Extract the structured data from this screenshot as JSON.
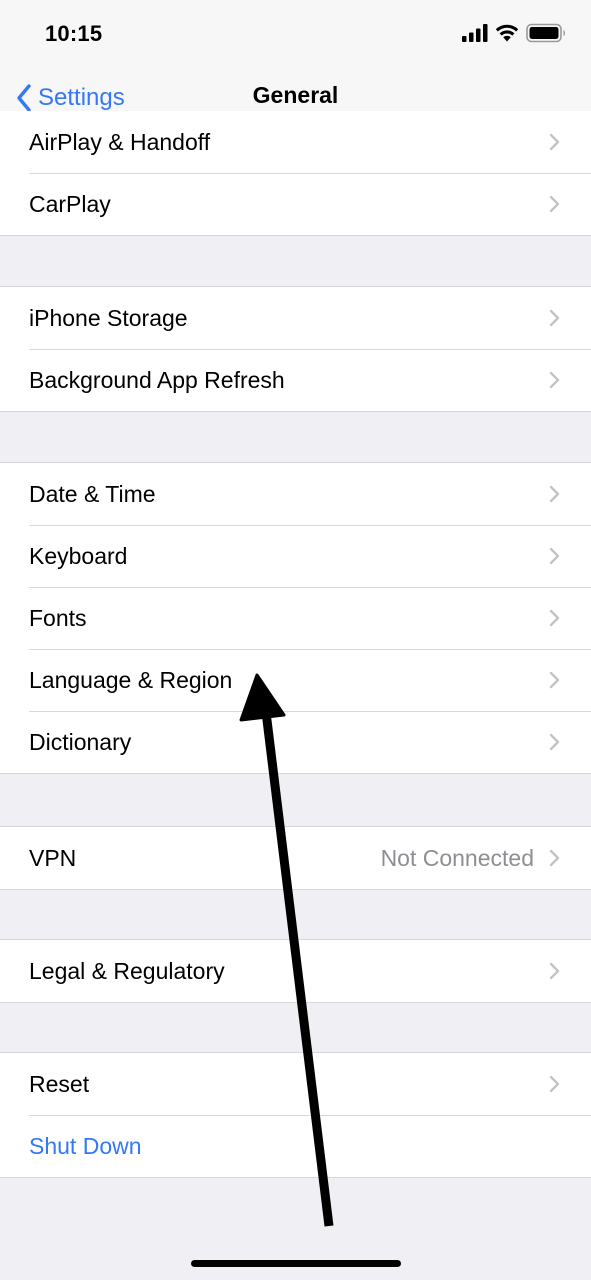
{
  "status_bar": {
    "time": "10:15",
    "icons": [
      "cellular-signal-icon",
      "wifi-icon",
      "battery-icon"
    ]
  },
  "nav": {
    "back_label": "Settings",
    "title": "General"
  },
  "groups": [
    {
      "rows": [
        {
          "label": "AirPlay & Handoff",
          "chevron": true
        },
        {
          "label": "CarPlay",
          "chevron": true
        }
      ]
    },
    {
      "rows": [
        {
          "label": "iPhone Storage",
          "chevron": true
        },
        {
          "label": "Background App Refresh",
          "chevron": true
        }
      ]
    },
    {
      "rows": [
        {
          "label": "Date & Time",
          "chevron": true
        },
        {
          "label": "Keyboard",
          "chevron": true
        },
        {
          "label": "Fonts",
          "chevron": true
        },
        {
          "label": "Language & Region",
          "chevron": true
        },
        {
          "label": "Dictionary",
          "chevron": true
        }
      ]
    },
    {
      "rows": [
        {
          "label": "VPN",
          "value": "Not Connected",
          "chevron": true
        }
      ]
    },
    {
      "rows": [
        {
          "label": "Legal & Regulatory",
          "chevron": true
        }
      ]
    },
    {
      "rows": [
        {
          "label": "Reset",
          "chevron": true
        },
        {
          "label": "Shut Down",
          "chevron": false,
          "action": true
        }
      ]
    }
  ],
  "colors": {
    "accent": "#3478f6",
    "background": "#efeff4",
    "secondary_text": "#8e8e93",
    "chevron": "#c4c4c7"
  }
}
